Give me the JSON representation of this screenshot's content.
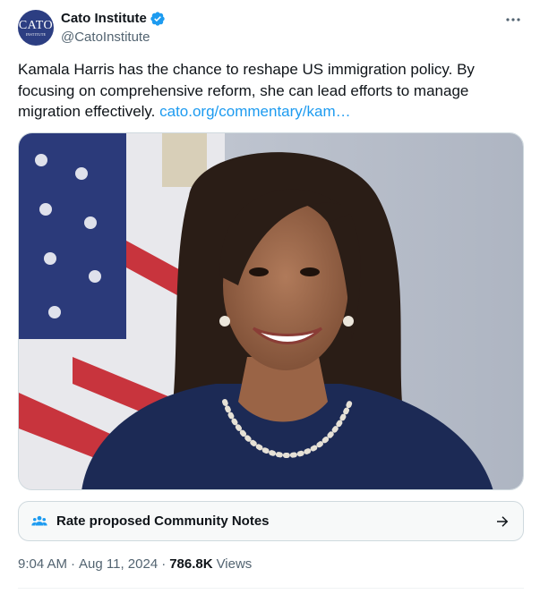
{
  "author": {
    "display_name": "Cato Institute",
    "handle": "@CatoInstitute",
    "avatar_text": "CATO",
    "avatar_sub": "INSTITUTE",
    "verified": true,
    "verified_color": "#1d9bf0",
    "avatar_color": "#2c3e82"
  },
  "tweet": {
    "text": "Kamala Harris has the chance to reshape US immigration policy. By focusing on comprehensive reform, she can lead efforts to manage migration effectively.",
    "link": "cato.org/commentary/kam…"
  },
  "media": {
    "icon": "portrait-photo"
  },
  "community_notes": {
    "label": "Rate proposed Community Notes"
  },
  "meta": {
    "time": "9:04 AM",
    "separator": "·",
    "date": "Aug 11, 2024",
    "views_count": "786.8K",
    "views_label": "Views"
  },
  "colors": {
    "text": "#0f1419",
    "secondary": "#536471",
    "link": "#1d9bf0",
    "border": "#cfd9de"
  }
}
